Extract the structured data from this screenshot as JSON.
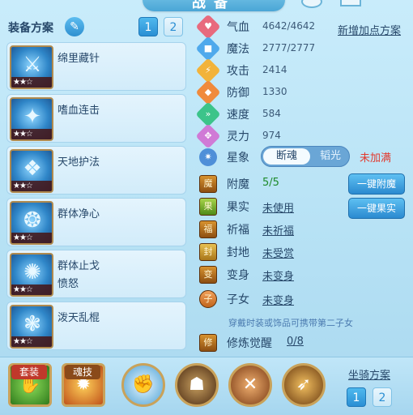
{
  "header": {
    "title": "战备"
  },
  "equip": {
    "title": "装备方案",
    "plan_buttons": [
      "1",
      "2"
    ],
    "skills": [
      {
        "name": "绵里藏针",
        "sub": "",
        "stars": "★★☆"
      },
      {
        "name": "嗜血连击",
        "sub": "",
        "stars": "★★☆"
      },
      {
        "name": "天地护法",
        "sub": "",
        "stars": "★★☆"
      },
      {
        "name": "群体净心",
        "sub": "",
        "stars": "★★☆"
      },
      {
        "name": "群体止戈",
        "sub": "愤怒",
        "stars": "★★☆"
      },
      {
        "name": "泼天乱棍",
        "sub": "",
        "stars": "★★☆"
      }
    ]
  },
  "stats": [
    {
      "label": "气血",
      "value": "4642/4642",
      "color": "#e86a7e",
      "icon": "heart-icon"
    },
    {
      "label": "魔法",
      "value": "2777/2777",
      "color": "#4fa9ec",
      "icon": "mana-icon"
    },
    {
      "label": "攻击",
      "value": "2414",
      "color": "#f2b33a",
      "icon": "attack-icon"
    },
    {
      "label": "防御",
      "value": "1330",
      "color": "#f08a3c",
      "icon": "shield-icon"
    },
    {
      "label": "速度",
      "value": "584",
      "color": "#3cc48a",
      "icon": "speed-icon"
    },
    {
      "label": "灵力",
      "value": "974",
      "color": "#d07ad6",
      "icon": "spirit-icon"
    }
  ],
  "add_plan": "新增加点方案",
  "xingxiang": {
    "label": "星象",
    "option_on": "断魂",
    "option_off": "韬光",
    "status": "未加满"
  },
  "extras": [
    {
      "label": "附魔",
      "value": "5/5",
      "green": true,
      "icon_char": "魔"
    },
    {
      "label": "果实",
      "value": "未使用",
      "green": false,
      "icon_char": "果"
    },
    {
      "label": "祈福",
      "value": "未祈福",
      "green": false,
      "icon_char": "福"
    },
    {
      "label": "封地",
      "value": "未受赏",
      "green": false,
      "icon_char": "封"
    },
    {
      "label": "变身",
      "value": "未变身",
      "green": false,
      "icon_char": "变"
    },
    {
      "label": "子女",
      "value": "未变身",
      "green": false,
      "icon_char": "子"
    }
  ],
  "actions": {
    "enchant": "一键附魔",
    "fruit": "一键果实"
  },
  "hint": "穿戴时装或饰品可携带第二子女",
  "cultivate": {
    "label": "修炼觉醒",
    "value": "0/8"
  },
  "bottom": {
    "tags": [
      "套装",
      "魂技"
    ],
    "mount_label": "坐骑方案",
    "mount_buttons": [
      "1",
      "2"
    ]
  }
}
